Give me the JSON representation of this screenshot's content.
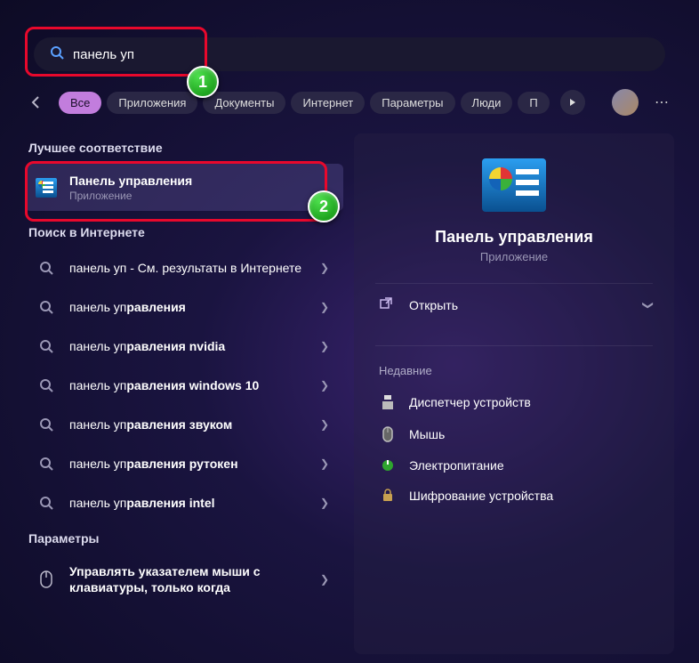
{
  "search": {
    "value": "панель уп"
  },
  "badges": {
    "one": "1",
    "two": "2"
  },
  "filters": {
    "all": "Все",
    "apps": "Приложения",
    "docs": "Документы",
    "web": "Интернет",
    "settings": "Параметры",
    "people": "Люди",
    "truncated": "П"
  },
  "left": {
    "best_match": "Лучшее соответствие",
    "top": {
      "title": "Панель управления",
      "subtitle": "Приложение"
    },
    "web_search": "Поиск в Интернете",
    "suggestions": [
      {
        "prefix": "панель уп",
        "suffix": "",
        "extra": " - См. результаты в Интернете"
      },
      {
        "prefix": "панель уп",
        "suffix": "равления",
        "extra": ""
      },
      {
        "prefix": "панель уп",
        "suffix": "равления nvidia",
        "extra": ""
      },
      {
        "prefix": "панель уп",
        "suffix": "равления windows 10",
        "extra": ""
      },
      {
        "prefix": "панель уп",
        "suffix": "равления звуком",
        "extra": ""
      },
      {
        "prefix": "панель уп",
        "suffix": "равления рутокен",
        "extra": ""
      },
      {
        "prefix": "панель уп",
        "suffix": "равления intel",
        "extra": ""
      }
    ],
    "settings_section": "Параметры",
    "setting_item": "Управлять указателем мыши с клавиатуры, только когда"
  },
  "right": {
    "title": "Панель управления",
    "subtitle": "Приложение",
    "open": "Открыть",
    "recent_header": "Недавние",
    "recent": [
      "Диспетчер устройств",
      "Мышь",
      "Электропитание",
      "Шифрование устройства"
    ]
  }
}
